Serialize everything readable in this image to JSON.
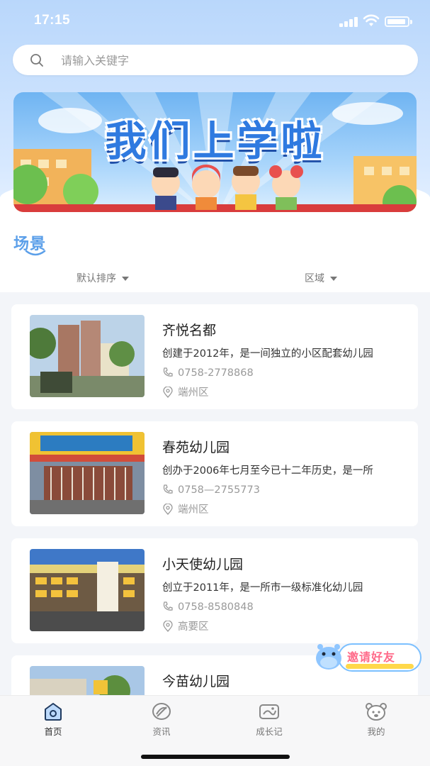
{
  "status_bar": {
    "time": "17:15"
  },
  "search": {
    "placeholder": "请输入关键字"
  },
  "banner": {
    "title": "我们上学啦"
  },
  "section": {
    "title": "场景"
  },
  "filters": {
    "sort_label": "默认排序",
    "area_label": "区域"
  },
  "schools": [
    {
      "name": "齐悦名都",
      "desc": "创建于2012年，是一间独立的小区配套幼儿园",
      "phone": "0758-2778868",
      "area": "端州区"
    },
    {
      "name": "春苑幼儿园",
      "desc": "创办于2006年七月至今已十二年历史，是一所",
      "phone": "0758—2755773",
      "area": "端州区"
    },
    {
      "name": "小天使幼儿园",
      "desc": "创立于2011年，是一所市一级标准化幼儿园",
      "phone": "0758-8580848",
      "area": "高要区"
    },
    {
      "name": "今苗幼儿园",
      "desc": "",
      "phone": "",
      "area": ""
    }
  ],
  "invite": {
    "label": "邀请好友"
  },
  "tabbar": {
    "items": [
      {
        "label": "首页",
        "icon": "home-icon",
        "active": true
      },
      {
        "label": "资讯",
        "icon": "news-icon",
        "active": false
      },
      {
        "label": "成长记",
        "icon": "growth-icon",
        "active": false
      },
      {
        "label": "我的",
        "icon": "profile-icon",
        "active": false
      }
    ]
  },
  "colors": {
    "accent": "#5b9fe9",
    "banner_title": "#2f7ae0",
    "invite": "#ff6b8a"
  }
}
